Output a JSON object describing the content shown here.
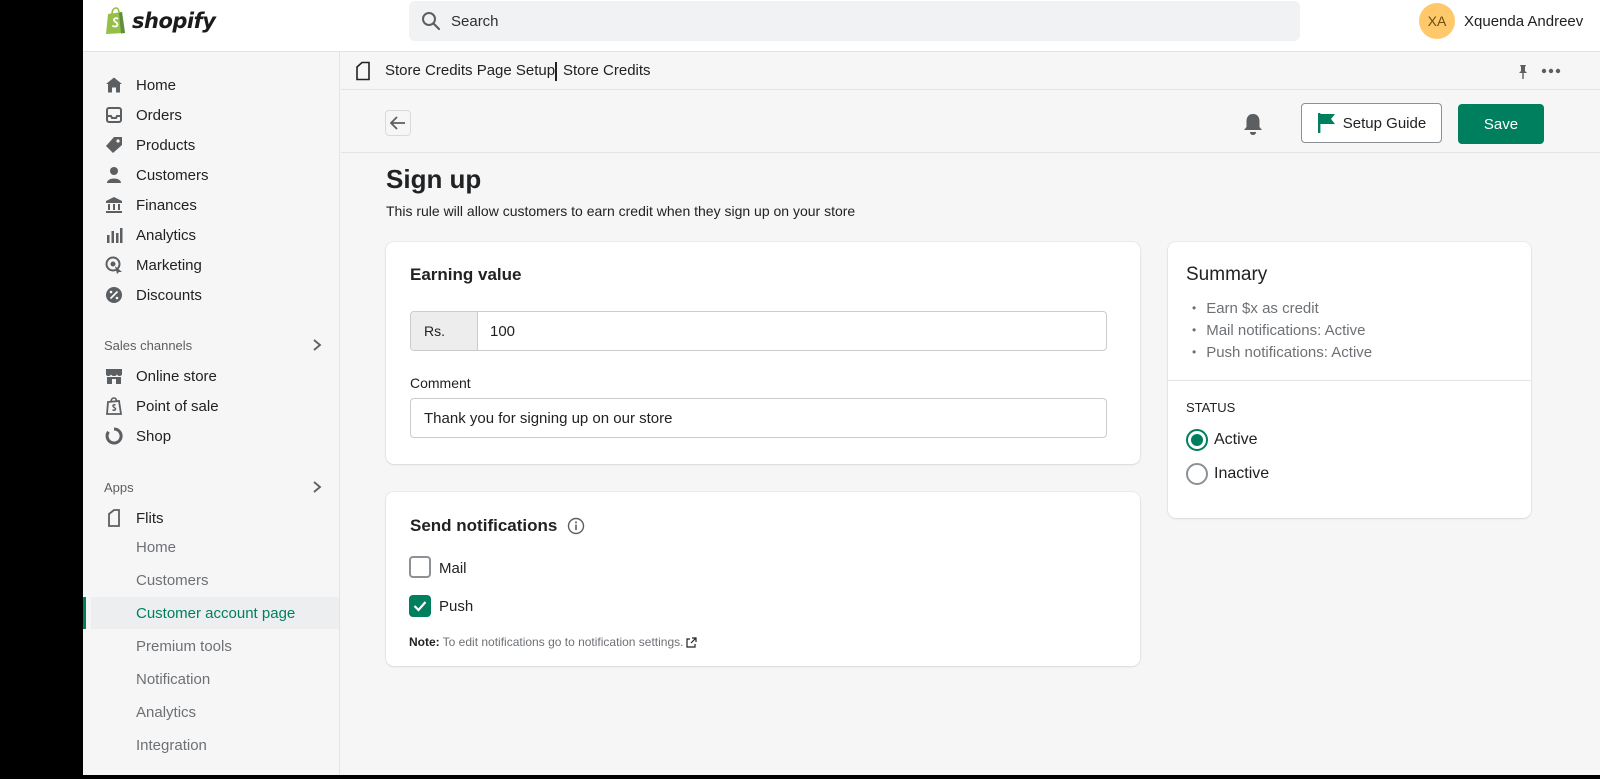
{
  "brand": {
    "name": "shopify",
    "color": "#95bf47"
  },
  "search": {
    "placeholder": "Search"
  },
  "user": {
    "initials": "XA",
    "name": "Xquenda Andreev"
  },
  "sidebar": {
    "main_items": [
      {
        "label": "Home",
        "icon": "home-icon"
      },
      {
        "label": "Orders",
        "icon": "orders-icon"
      },
      {
        "label": "Products",
        "icon": "tag-icon"
      },
      {
        "label": "Customers",
        "icon": "person-icon"
      },
      {
        "label": "Finances",
        "icon": "bank-icon"
      },
      {
        "label": "Analytics",
        "icon": "bar-chart-icon"
      },
      {
        "label": "Marketing",
        "icon": "target-icon"
      },
      {
        "label": "Discounts",
        "icon": "discount-icon"
      }
    ],
    "sales_channels_label": "Sales channels",
    "sales_channels": [
      {
        "label": "Online store",
        "icon": "store-icon"
      },
      {
        "label": "Point of sale",
        "icon": "pos-bag-icon"
      },
      {
        "label": "Shop",
        "icon": "shop-icon"
      }
    ],
    "apps_label": "Apps",
    "app": {
      "label": "Flits",
      "icon": "flits-icon"
    },
    "app_subitems": [
      {
        "label": "Home"
      },
      {
        "label": "Customers"
      },
      {
        "label": "Customer account page",
        "active": true
      },
      {
        "label": "Premium tools"
      },
      {
        "label": "Notification"
      },
      {
        "label": "Analytics"
      },
      {
        "label": "Integration"
      }
    ]
  },
  "breadcrumb": {
    "parent": "Store Credits Page Setup",
    "current": "Store Credits"
  },
  "toolbar": {
    "setup_guide": "Setup Guide",
    "save": "Save"
  },
  "page": {
    "title": "Sign up",
    "description": "This rule will allow customers to earn credit when they sign up on your store"
  },
  "earning": {
    "title": "Earning value",
    "prefix": "Rs.",
    "value": "100",
    "comment_label": "Comment",
    "comment_value": "Thank you for signing up on our store"
  },
  "notifications": {
    "title": "Send notifications",
    "mail_label": "Mail",
    "mail_checked": false,
    "push_label": "Push",
    "push_checked": true,
    "note_label": "Note:",
    "note_text": "To edit notifications go to notification settings."
  },
  "summary": {
    "title": "Summary",
    "items": [
      "Earn $x as credit",
      "Mail notifications: Active",
      "Push notifications: Active"
    ],
    "status_label": "STATUS",
    "active_label": "Active",
    "inactive_label": "Inactive",
    "selected": "Active"
  },
  "colors": {
    "primary": "#007f5f",
    "avatar": "#ffc96b"
  }
}
